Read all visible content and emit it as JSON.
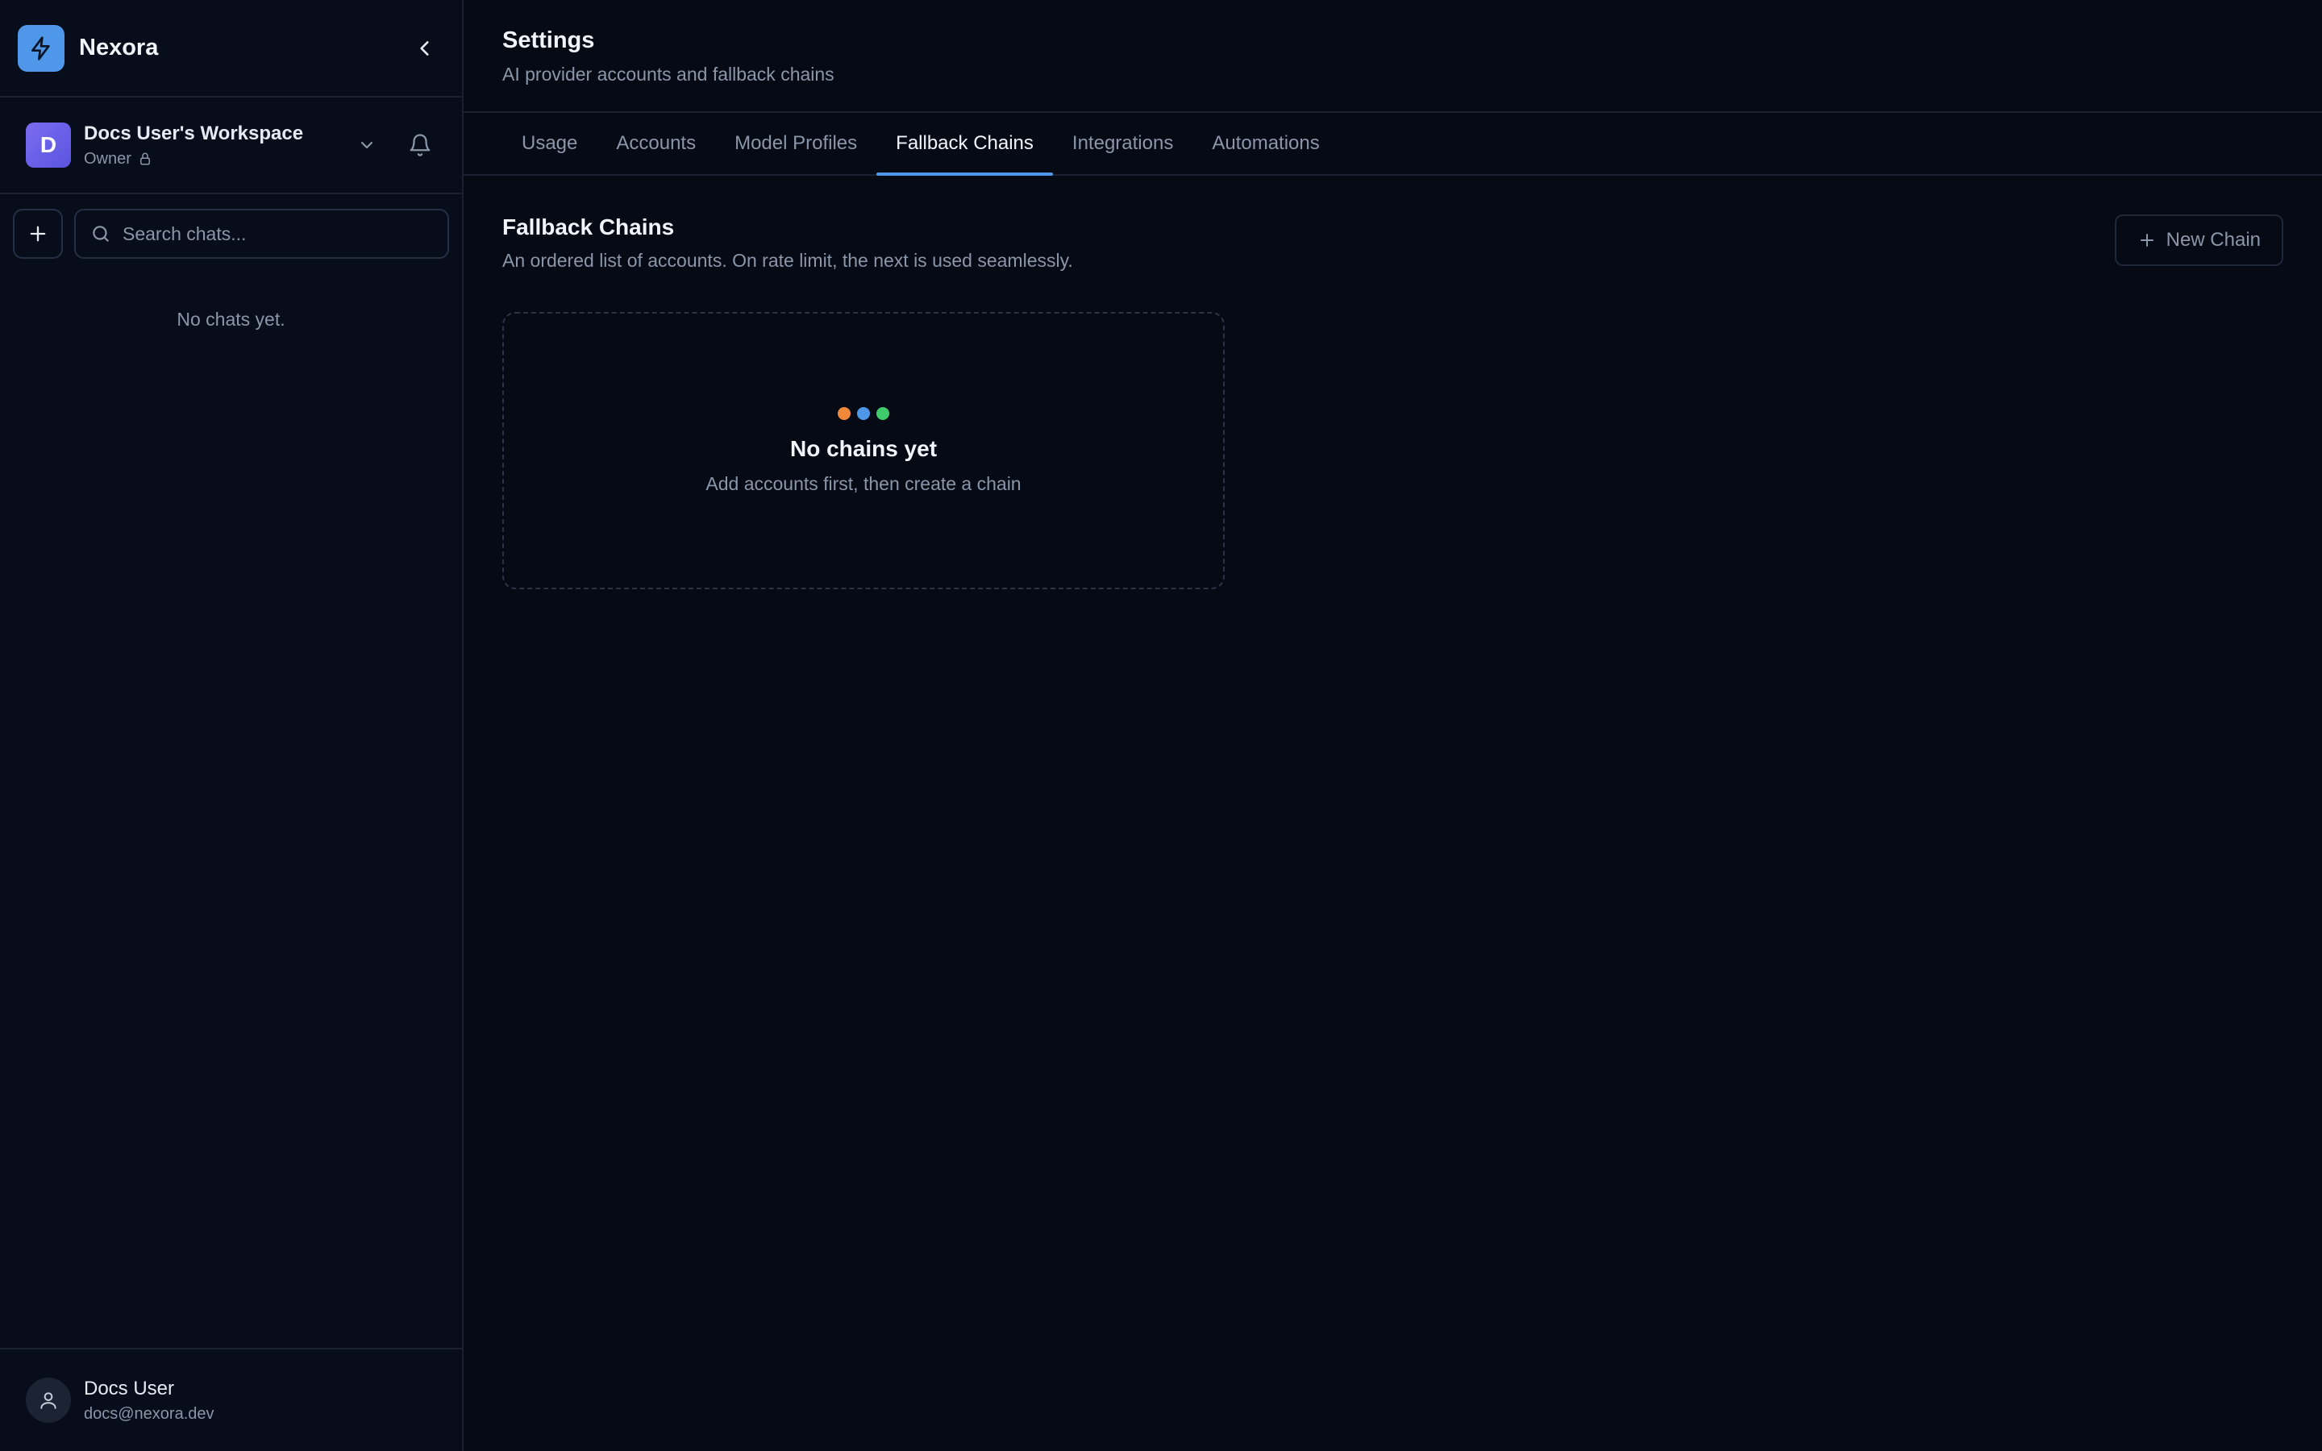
{
  "sidebar": {
    "brand_name": "Nexora",
    "workspace": {
      "avatar_letter": "D",
      "name": "Docs User's Workspace",
      "role": "Owner"
    },
    "search": {
      "placeholder": "Search chats..."
    },
    "empty_text": "No chats yet.",
    "user": {
      "name": "Docs User",
      "email": "docs@nexora.dev"
    }
  },
  "header": {
    "title": "Settings",
    "subtitle": "AI provider accounts and fallback chains"
  },
  "tabs": [
    {
      "label": "Usage",
      "active": false
    },
    {
      "label": "Accounts",
      "active": false
    },
    {
      "label": "Model Profiles",
      "active": false
    },
    {
      "label": "Fallback Chains",
      "active": true
    },
    {
      "label": "Integrations",
      "active": false
    },
    {
      "label": "Automations",
      "active": false
    }
  ],
  "section": {
    "title": "Fallback Chains",
    "description": "An ordered list of accounts. On rate limit, the next is used seamlessly.",
    "new_button_label": "New Chain"
  },
  "empty_state": {
    "title": "No chains yet",
    "description": "Add accounts first, then create a chain",
    "dot_colors": [
      "#f08a3a",
      "#4f97e8",
      "#3fca6b"
    ]
  },
  "colors": {
    "accent": "#4f97e8",
    "background": "#050a15",
    "sidebar": "#070d1b"
  }
}
